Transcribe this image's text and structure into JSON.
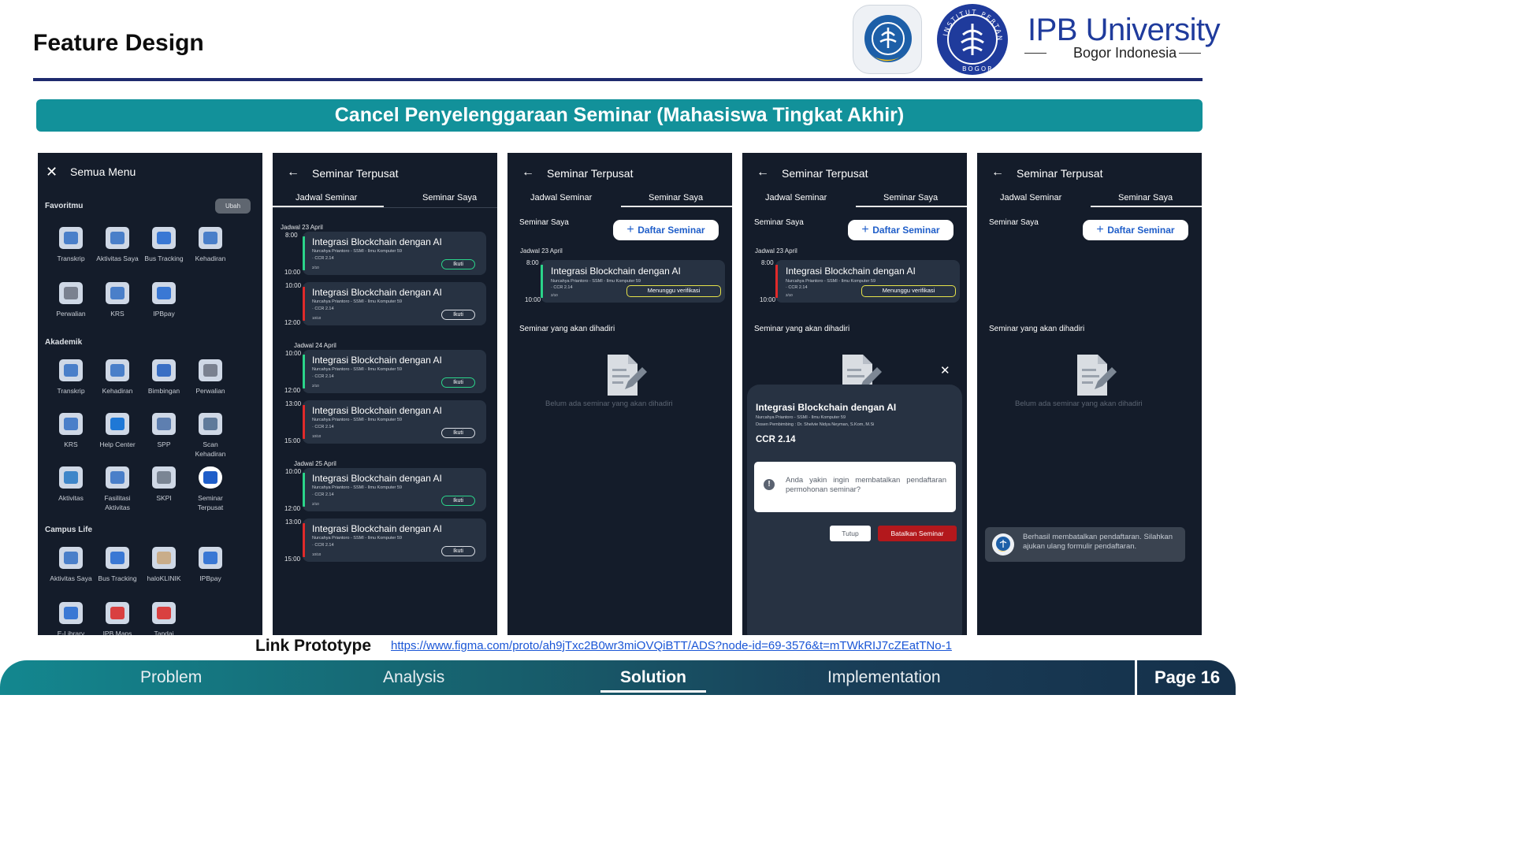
{
  "header": {
    "title": "Feature Design",
    "university_name": "IPB University",
    "university_sub": "Bogor Indonesia",
    "seal_text": "INSTITUT PERTANIAN BOGOR"
  },
  "banner": "Cancel Penyelenggaraan Seminar (Mahasiswa Tingkat Akhir)",
  "screen1": {
    "title": "Semua Menu",
    "favorit_label": "Favoritmu",
    "ubah": "Ubah",
    "favorit_items": [
      {
        "label": "Transkrip",
        "icon": "transcript-icon"
      },
      {
        "label": "Aktivitas Saya",
        "icon": "activity-icon"
      },
      {
        "label": "Bus Tracking",
        "icon": "bus-icon"
      },
      {
        "label": "Kehadiran",
        "icon": "attendance-icon"
      },
      {
        "label": "Perwalian",
        "icon": "graduation-icon"
      },
      {
        "label": "KRS",
        "icon": "krs-icon"
      },
      {
        "label": "IPBpay",
        "icon": "card-icon"
      }
    ],
    "akademik_label": "Akademik",
    "akademik_items": [
      {
        "label": "Transkrip",
        "icon": "transcript-icon"
      },
      {
        "label": "Kehadiran",
        "icon": "attendance-icon"
      },
      {
        "label": "Bimbingan",
        "icon": "mentoring-icon"
      },
      {
        "label": "Perwalian",
        "icon": "graduation-icon"
      },
      {
        "label": "KRS",
        "icon": "krs-icon"
      },
      {
        "label": "Help Center",
        "icon": "phone-icon"
      },
      {
        "label": "SPP",
        "icon": "spp-icon"
      },
      {
        "label": "Scan Kehadiran",
        "icon": "scan-icon"
      },
      {
        "label": "Aktivitas",
        "icon": "mbkm-icon"
      },
      {
        "label": "Fasilitasi Aktivitas",
        "icon": "facility-icon"
      },
      {
        "label": "SKPI",
        "icon": "skpi-icon"
      },
      {
        "label": "Seminar Terpusat",
        "icon": "seminar-icon"
      }
    ],
    "campus_label": "Campus Life",
    "campus_items": [
      {
        "label": "Aktivitas Saya",
        "icon": "activity-icon"
      },
      {
        "label": "Bus Tracking",
        "icon": "bus-icon"
      },
      {
        "label": "haloKLINIK",
        "icon": "doctor-icon"
      },
      {
        "label": "IPBpay",
        "icon": "card-icon"
      },
      {
        "label": "E-Library",
        "icon": "library-icon"
      },
      {
        "label": "IPB Maps",
        "icon": "map-icon"
      },
      {
        "label": "Tandai",
        "icon": "bookmark-icon"
      }
    ]
  },
  "common": {
    "screen_title": "Seminar Terpusat",
    "tab_jadwal": "Jadwal Seminar",
    "tab_saya": "Seminar Saya",
    "seminar_title": "Integrasi Blockchain dengan AI",
    "seminar_speaker": "Nurcahya Priantoro - SSMI - Ilmu Komputer 59",
    "seminar_room": "CCR 2.14",
    "ikuti": "Ikuti",
    "seminar_saya_label": "Seminar Saya",
    "daftar": "Daftar Seminar",
    "akan_dihadiri": "Seminar yang akan dihadiri",
    "empty": "Belum ada seminar yang akan dihadiri",
    "menunggu": "Menunggu verifikasi",
    "jadwal_23": "Jadwal 23 April"
  },
  "screen2": {
    "days": [
      {
        "label": "Jadwal 23 April",
        "items": [
          {
            "start": "8:00",
            "end": "10:00",
            "count": "2/10",
            "status": "green"
          },
          {
            "start": "10:00",
            "end": "12:00",
            "count": "10/10",
            "status": "red"
          }
        ]
      },
      {
        "label": "Jadwal 24 April",
        "items": [
          {
            "start": "10:00",
            "end": "12:00",
            "count": "2/10",
            "status": "green"
          },
          {
            "start": "13:00",
            "end": "15:00",
            "count": "10/10",
            "status": "red"
          }
        ]
      },
      {
        "label": "Jadwal 25 April",
        "items": [
          {
            "start": "10:00",
            "end": "12:00",
            "count": "2/10",
            "status": "green"
          },
          {
            "start": "13:00",
            "end": "15:00",
            "count": "10/10",
            "status": "red"
          }
        ]
      }
    ]
  },
  "screen3": {
    "start": "8:00",
    "end": "10:00",
    "count": "2/10"
  },
  "screen4": {
    "modal_title": "Integrasi Blockchain dengan AI",
    "modal_speaker": "Nurcahya Priantoro - SSMI - Ilmu Komputer 59",
    "modal_dosen": "Dosen Pembimbing : Dr. Shelvie Nidya Neyman, S.Kom, M.Si",
    "modal_room": "CCR 2.14",
    "confirm": "Anda yakin ingin membatalkan pendaftaran permohonan seminar?",
    "tutup": "Tutup",
    "batalkan": "Batalkan Seminar"
  },
  "screen5": {
    "toast": "Berhasil membatalkan pendaftaran. Silahkan ajukan ulang formulir pendaftaran."
  },
  "link": {
    "label": "Link Prototype",
    "url": "https://www.figma.com/proto/ah9jTxc2B0wr3miOVQiBTT/ADS?node-id=69-3576&t=mTWkRIJ7cZEatTNo-1"
  },
  "footer": {
    "nav": [
      "Problem",
      "Analysis",
      "Solution",
      "Implementation"
    ],
    "active": "Solution",
    "page": "Page 16"
  },
  "colors": {
    "accent": "#12919a",
    "navy": "#1e2a6e",
    "green": "#2bd48a",
    "red": "#e02a2a",
    "yellow": "#e6e24a",
    "danger": "#b3181c"
  }
}
